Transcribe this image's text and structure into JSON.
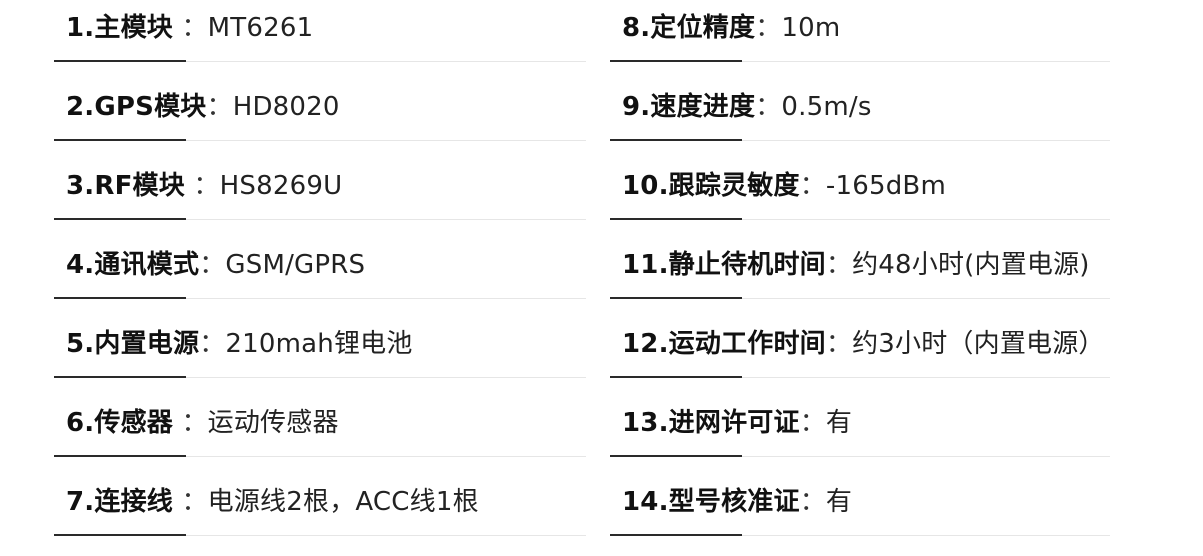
{
  "specs_left": [
    {
      "num": "1.",
      "label": "主模块",
      "sep": "  ：",
      "value": "MT6261"
    },
    {
      "num": "2.",
      "label": "GPS模块",
      "sep": "：",
      "value": "HD8020"
    },
    {
      "num": "3.",
      "label": "RF模块",
      "sep": "  ：",
      "value": "HS8269U"
    },
    {
      "num": "4.",
      "label": "通讯模式",
      "sep": "：",
      "value": "GSM/GPRS"
    },
    {
      "num": "5.",
      "label": "内置电源",
      "sep": "：",
      "value": "210mah锂电池"
    },
    {
      "num": "6.",
      "label": "传感器",
      "sep": "  ：",
      "value": "运动传感器"
    },
    {
      "num": "7.",
      "label": "连接线",
      "sep": "  ：",
      "value": "电源线2根，ACC线1根"
    }
  ],
  "specs_right": [
    {
      "num": "8.",
      "label": "定位精度",
      "sep": "：",
      "value": "10m"
    },
    {
      "num": "9.",
      "label": "速度进度",
      "sep": "：",
      "value": "0.5m/s"
    },
    {
      "num": "10.",
      "label": "跟踪灵敏度",
      "sep": "：",
      "value": "-165dBm"
    },
    {
      "num": "11.",
      "label": "静止待机时间",
      "sep": "：",
      "value": "约48小时(内置电源)"
    },
    {
      "num": "12.",
      "label": "运动工作时间",
      "sep": "：",
      "value": "约3小时（内置电源）"
    },
    {
      "num": "13.",
      "label": "进网许可证",
      "sep": "：",
      "value": "有"
    },
    {
      "num": "14.",
      "label": "型号核准证",
      "sep": "：",
      "value": "有"
    }
  ]
}
